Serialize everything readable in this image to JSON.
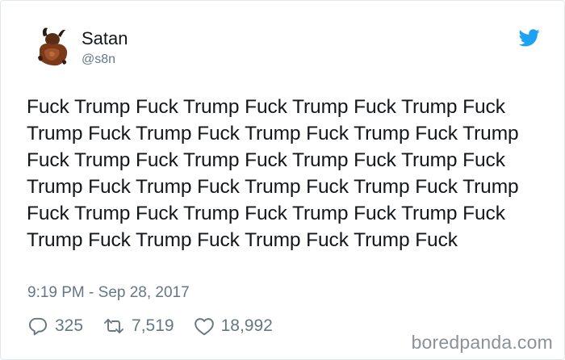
{
  "tweet": {
    "display_name": "Satan",
    "handle": "@s8n",
    "text": "Fuck Trump Fuck Trump Fuck Trump Fuck Trump Fuck Trump Fuck Trump Fuck Trump Fuck Trump Fuck Trump Fuck Trump Fuck Trump Fuck Trump Fuck Trump Fuck Trump Fuck Trump Fuck Trump Fuck Trump Fuck Trump Fuck Trump Fuck Trump Fuck Trump Fuck Trump Fuck Trump Fuck Trump Fuck Trump Fuck Trump Fuck",
    "timestamp": "9:19 PM - Sep 28, 2017",
    "replies": "325",
    "retweets": "7,519",
    "likes": "18,992"
  },
  "icons": {
    "brand": "twitter-bird-icon",
    "reply": "reply-icon",
    "retweet": "retweet-icon",
    "like": "heart-icon"
  },
  "colors": {
    "brand_blue": "#1da1f2",
    "text_primary": "#14171a",
    "text_secondary": "#657786",
    "border": "#e1e8ed"
  },
  "watermark": "boredpanda.com"
}
